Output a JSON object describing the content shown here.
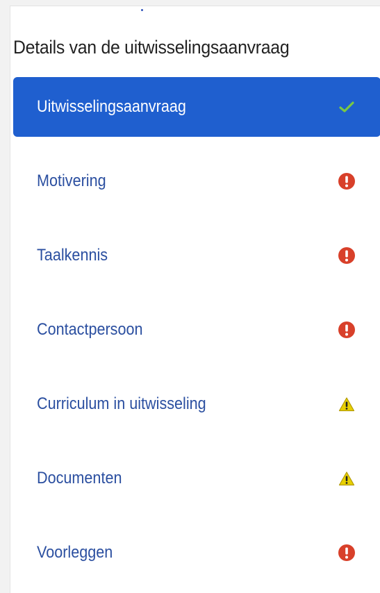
{
  "panel": {
    "title": "Details van de uitwisselingsaanvraag"
  },
  "nav": {
    "items": [
      {
        "label": "Uitwisselingsaanvraag",
        "status": "check-icon",
        "active": true
      },
      {
        "label": "Motivering",
        "status": "error-icon",
        "active": false
      },
      {
        "label": "Taalkennis",
        "status": "error-icon",
        "active": false
      },
      {
        "label": "Contactpersoon",
        "status": "error-icon",
        "active": false
      },
      {
        "label": "Curriculum in uitwisseling",
        "status": "warning-icon",
        "active": false
      },
      {
        "label": "Documenten",
        "status": "warning-icon",
        "active": false
      },
      {
        "label": "Voorleggen",
        "status": "error-icon",
        "active": false
      }
    ]
  },
  "colors": {
    "active_background": "#1f5fcf",
    "link_text": "#2b4fa0",
    "check": "#7ac943",
    "error": "#d8402a",
    "warning": "#e8d000"
  }
}
